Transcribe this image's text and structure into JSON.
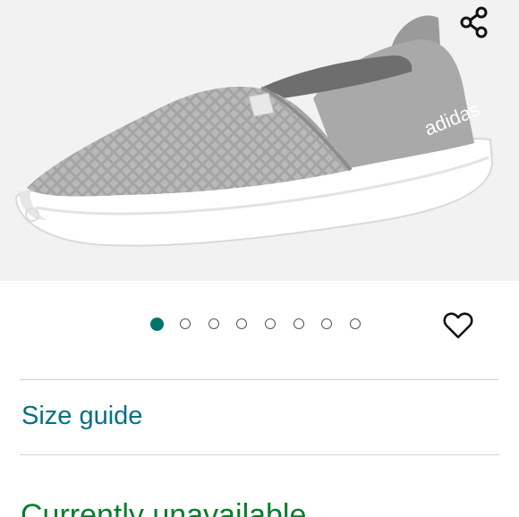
{
  "product": {
    "images_count": 8,
    "active_image_index": 0
  },
  "actions": {
    "share_icon": "share-icon",
    "wishlist_icon": "heart-outline-icon"
  },
  "size_guide": {
    "label": "Size guide"
  },
  "availability": {
    "text": "Currently unavailable"
  },
  "colors": {
    "link": "#007185",
    "availability": "#067d2b",
    "dot_active": "#00736a",
    "image_bg": "#f2f2f2"
  }
}
